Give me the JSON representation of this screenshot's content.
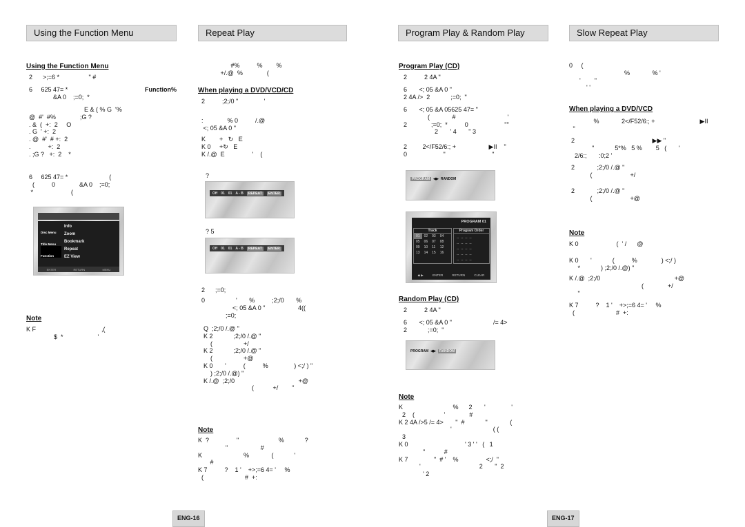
{
  "headers": [
    "Using the Function Menu",
    "Repeat Play",
    "Program Play & Random Play",
    "Slow Repeat Play"
  ],
  "page_numbers": [
    "ENG-16",
    "ENG-17"
  ],
  "col1": {
    "subheading": "Using the Function Menu",
    "p1": [
      "2      >;=6 *                 \" #"
    ],
    "p2": [
      "6     625 47= *",
      "              &A 0    ;=0;  *"
    ],
    "p2_bold": "Function%",
    "p3": [
      "                                E & ( % G  '%",
      "@  #'  #%              ;G ?",
      ". &  (  +:  2     O",
      ". G  ' +:  2",
      ". @  #'  # +:  2",
      ".          +:  2",
      ". ;G ?   +:  2    *"
    ],
    "p4": [
      "6     625 47= *                        (",
      "  (          0              &A 0    ;=0;",
      " *                      ("
    ],
    "menu_shot": {
      "side": [
        "Disc Menu",
        "Title Menu",
        "Function",
        "Setup"
      ],
      "items": [
        "Info",
        "Zoom",
        "Bookmark",
        "Repeat",
        "EZ View"
      ],
      "footer": [
        "ENTER",
        "RETURN",
        "MENU"
      ]
    },
    "note_title": "Note",
    "note": [
      "K F                                      ,(",
      "                $  *                    '"
    ]
  },
  "col2": {
    "p0": [
      "                   #%          %        %",
      "             +/.@  %              ("
    ],
    "subheading": "When playing a DVD/VCD/CD",
    "p1": [
      "2          ;2;/0 \"               '"
    ],
    "p2": [
      ":              % 0          /.@",
      " <; 05 &A 0 \""
    ],
    "p3": [
      "K        +   ↻   E",
      "K 0     +↻   E",
      "K /.@  E                '    ("
    ],
    "q1": "?",
    "osd": [
      "Off",
      "01",
      "01",
      "A - B",
      "REPEAT",
      "ENTER"
    ],
    "q2": "? 5",
    "p4": [
      "2      ;=0;"
    ],
    "p5": [
      "0                  '       %          ;2;/0       %",
      "                  <; 05 &A 0 \"                   4((",
      "              ;=0;"
    ],
    "p6": [
      "Q  ;2;/0 /.@ \"",
      "K 2            ;2;/0 /.@ \"",
      "    (                  +/",
      "K 2            ;2;/0 /.@ \"",
      "    (                  +@",
      "K 0       '          (          %               ) <;/ ) \"",
      "    ) ;2;/0 /.@) \"",
      "K /.@  ;2;/0                                     +@",
      "                            (           +/        \""
    ],
    "note_title": "Note",
    "note": [
      "K  ?                \"                       %            ?",
      "                \"                   #",
      "K                        %             (            '",
      "       #",
      "K 7          ?    1 '    +>;=6 4= '     %",
      "  (                        #  +:"
    ]
  },
  "col3": {
    "subheading1": "Program Play (CD)",
    "p1": [
      "2          2 4A \""
    ],
    "p2": [
      "6       <; 05 &A 0 \"",
      "2 4A />  2            ;=0;  \""
    ],
    "p3": [
      "6       <; 05 &A 05625 47= \"",
      "              (             #                              '",
      "2              ;=0;  *          0                     \"\"",
      "                  2       ' 4       \" 3"
    ],
    "p4": [
      "2         2</F52/6:; +                   ▶II    \"",
      "0                     \"                           \""
    ],
    "small_shot": [
      "PROGRAM",
      "RANDOM"
    ],
    "program_shot": {
      "title": "PROGRAM 01",
      "track_label": "Track",
      "order_label": "Program  Order",
      "tracks": [
        [
          "01",
          "02",
          "03",
          "04"
        ],
        [
          "05",
          "06",
          "07",
          "08"
        ],
        [
          "09",
          "10",
          "11",
          "12"
        ],
        [
          "13",
          "14",
          "15",
          "16"
        ]
      ],
      "order": [
        "--  --  --  --",
        "--  --  --  --",
        "--  --  --  --",
        "--  --  --  --",
        "--  --  --  --"
      ],
      "footer": [
        "ENTER",
        "RETURN",
        "CLEAR"
      ]
    },
    "subheading2": "Random Play (CD)",
    "p5": [
      "2          2 4A \""
    ],
    "p6": [
      "6       <; 05 &A 0 \"                        /= 4>",
      "2            ;=0;  \""
    ],
    "note_title": "Note",
    "note": [
      "K                             %      2       '               '",
      "  2    (                 '              #",
      "K 2 4A />5 /= 4>       \"  #            \"             (",
      "                              '                        ( (",
      "  3",
      "K 0                                 ' 3 ' '   (   1",
      "              \"           #",
      "K 7               \"  # '    %                <;/  \"",
      "            '                                  2       \"  2",
      "              ' 2"
    ]
  },
  "col4": {
    "p0": [
      "0     (",
      "                                %             % '",
      "      '        \"",
      "          ' '"
    ],
    "subheading": "When playing a DVD/VCD",
    "p1": [
      "             %             2</F52/6:; +                          ▶II",
      " \""
    ],
    "p2": [
      "2                                             ▶▶ \"",
      "            \"            5*%   5 %        5   (       '",
      "  2/6:;       :0;2 '"
    ],
    "p3": [
      "2             ;2;/0 /.@ \"",
      "           (                      +/"
    ],
    "p4": [
      "2             ;2;/0 /.@ \"",
      "           (                      +@"
    ],
    "note_title": "Note",
    "note1": [
      "K 0                      (  ' /      @"
    ],
    "note2": [
      "K 0       '            (          %              ) <;/ )",
      "     *            ) ;2;/0 /.@) \""
    ],
    "note3": [
      "K /.@  ;2;/0                                           +@",
      "                                          (              +/",
      "     \""
    ],
    "note4": [
      "K 7          ?    1 '    +>;=6 4= '     %",
      "  (                        #  +:"
    ]
  }
}
